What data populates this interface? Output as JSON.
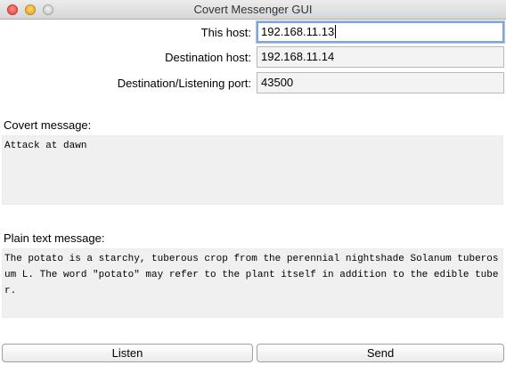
{
  "window": {
    "title": "Covert Messenger GUI"
  },
  "form": {
    "this_host_label": "This host:",
    "this_host_value": "192.168.11.13",
    "destination_host_label": "Destination host:",
    "destination_host_value": "192.168.11.14",
    "port_label": "Destination/Listening port:",
    "port_value": "43500"
  },
  "covert": {
    "label": "Covert message:",
    "text": "Attack at dawn"
  },
  "plain": {
    "label": "Plain text message:",
    "text": "The potato is a starchy, tuberous crop from the perennial nightshade Solanum tuberosum L. The word \"potato\" may refer to the plant itself in addition to the edible tuber."
  },
  "buttons": {
    "listen_label": "Listen",
    "send_label": "Send"
  }
}
